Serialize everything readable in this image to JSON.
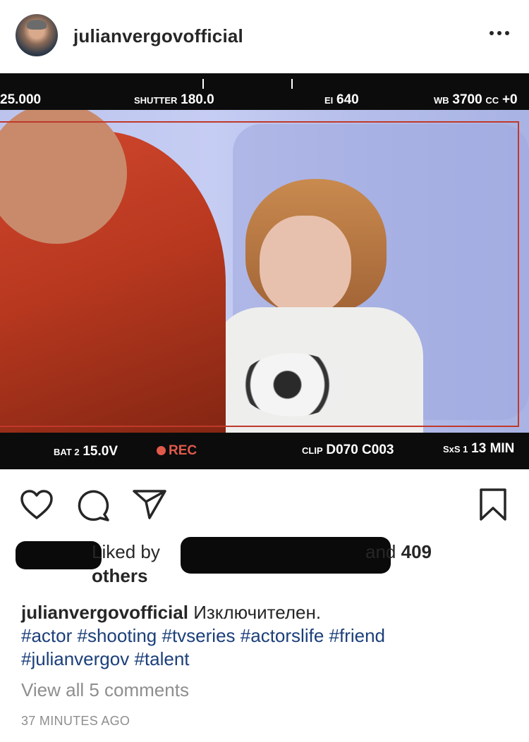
{
  "post": {
    "username": "julianvergovofficial",
    "more_icon": "ellipsis-icon"
  },
  "viewfinder": {
    "iso_value": "25.000",
    "shutter_label": "SHUTTER",
    "shutter_value": "180.0",
    "ei_label": "EI",
    "ei_value": "640",
    "wb_label": "WB",
    "wb_value": "3700",
    "cc_label": "CC",
    "cc_value": "+0",
    "bat_label": "BAT 2",
    "bat_value": "15.0V",
    "rec_label": "REC",
    "clip_label": "CLIP",
    "clip_value": "D070 C003",
    "sxs_label": "SxS 1",
    "sxs_value": "13 MIN",
    "accent_color": "#e05a4a"
  },
  "actions": {
    "like_icon": "heart-icon",
    "comment_icon": "comment-icon",
    "share_icon": "send-icon",
    "save_icon": "bookmark-icon"
  },
  "likes": {
    "liked_by": "Liked by",
    "and": "and",
    "count": "409",
    "others": "others"
  },
  "caption": {
    "username": "julianvergovofficial",
    "text": "Изключителен.",
    "tags_line1": [
      "#actor",
      "#shooting",
      "#tvseries",
      "#actorslife",
      "#friend"
    ],
    "tags_line2": [
      "#julianvergov",
      "#talent"
    ],
    "tag_color": "#1b3f7a"
  },
  "comments": {
    "view_all": "View all 5 comments"
  },
  "timestamp": "37 MINUTES AGO"
}
